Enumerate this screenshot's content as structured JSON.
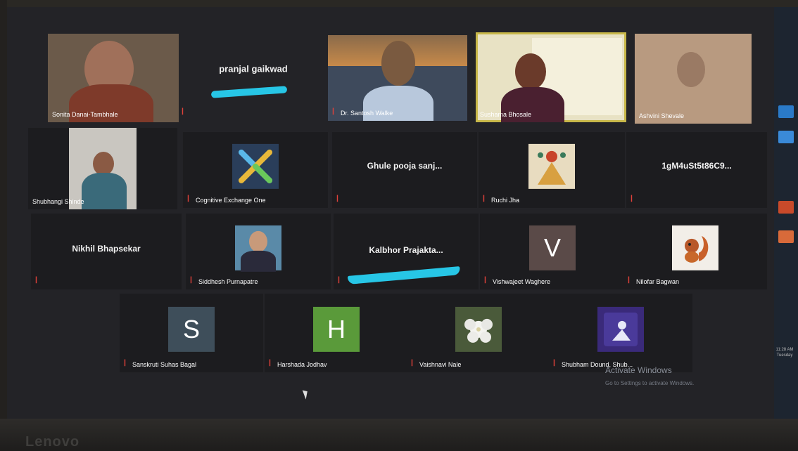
{
  "row1": [
    {
      "name": "Sonita Danai-Tambhale",
      "kind": "video"
    },
    {
      "name": "pranjal gaikwad",
      "kind": "name"
    },
    {
      "name": "Dr. Santosh Walke",
      "kind": "video"
    },
    {
      "name": "Sushama Bhosale",
      "kind": "video"
    },
    {
      "name": "Ashvini Shevale",
      "kind": "video"
    }
  ],
  "row2": [
    {
      "name": "Shubhangi Shinde",
      "kind": "video"
    },
    {
      "name": "Cognitive Exchange One",
      "kind": "avatar"
    },
    {
      "name": "Ghule pooja sanj...",
      "kind": "name"
    },
    {
      "name": "Ruchi Jha",
      "kind": "avatar"
    },
    {
      "name": "1gM4uSt5t86C9...",
      "kind": "name"
    }
  ],
  "row3": [
    {
      "name": "Nikhil Bhapsekar",
      "kind": "name"
    },
    {
      "name": "Siddhesh Purnapatre",
      "kind": "avatar"
    },
    {
      "name": "Kalbhor Prajakta...",
      "kind": "name"
    },
    {
      "name": "Vishwajeet Waghere",
      "kind": "avatar",
      "letter": "V"
    },
    {
      "name": "Nilofar Bagwan",
      "kind": "avatar"
    }
  ],
  "row4": [
    {
      "name": "Sanskruti Suhas Bagal",
      "kind": "avatar",
      "letter": "S"
    },
    {
      "name": "Harshada Jodhav",
      "kind": "avatar",
      "letter": "H"
    },
    {
      "name": "Vaishnavi Nale",
      "kind": "avatar"
    },
    {
      "name": "Shubham Dound, Shub...",
      "kind": "avatar"
    }
  ],
  "windows_notice": {
    "title": "Activate Windows",
    "subtitle": "Go to Settings to activate Windows."
  },
  "taskbar": {
    "time": "11:28 AM",
    "day": "Tuesday"
  },
  "device_brand": "Lenovo",
  "colors": {
    "highlight_border": "#c8b84a",
    "marker": "#27c6e6",
    "mute": "#e0413a"
  }
}
